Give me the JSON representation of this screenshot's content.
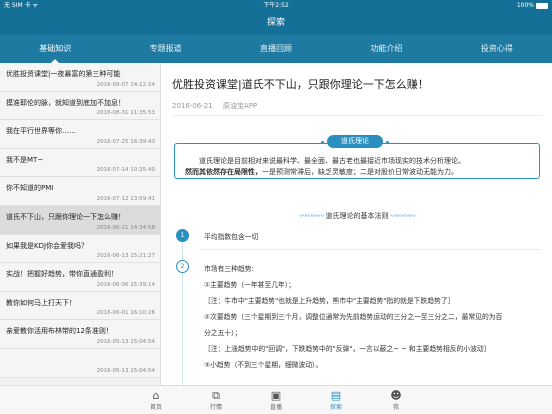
{
  "status_bar": {
    "carrier": "无 SIM 卡 ᯤ",
    "time": "下午2:52",
    "battery": "100%"
  },
  "nav": {
    "title": "探索"
  },
  "tabs": [
    {
      "label": "基础知识"
    },
    {
      "label": "专题报道"
    },
    {
      "label": "直播回顾"
    },
    {
      "label": "功能介绍"
    },
    {
      "label": "投资心得"
    }
  ],
  "list": [
    {
      "title": "优胜投资课堂|一夜暴富的第三种可能",
      "date": "2016-09-07 14:12:24"
    },
    {
      "title": "摸准耶伦的脉，就知道到底加不加息！",
      "date": "2016-08-31 11:35:53"
    },
    {
      "title": "我在平行世界等你……",
      "date": "2016-07-25 16:39:43"
    },
    {
      "title": "我不是MT~",
      "date": "2016-07-14 10:25:40"
    },
    {
      "title": "你不知道的PMI",
      "date": "2016-07-12 13:59:41"
    },
    {
      "title": "道氏不下山，只跟你理论一下怎么赚！",
      "date": "2016-06-21 14:34:58"
    },
    {
      "title": "如果我是KDJ你会爱我吗？",
      "date": "2016-06-13 15:21:27"
    },
    {
      "title": "实战！把握好趋势，带你直通盈利！",
      "date": "2016-06-06 15:39:14"
    },
    {
      "title": "教你如何马上打天下！",
      "date": "2016-06-01 16:10:26"
    },
    {
      "title": "亲爱教你活用布林带的12条准则！",
      "date": "2016-05-13 15:04:54"
    },
    {
      "title": "",
      "date": "2016-05-13 15:04:54"
    }
  ],
  "article": {
    "title": "优胜投资课堂|道氏不下山，只跟你理论一下怎么赚！",
    "date": "2016-06-21",
    "source": "原油宝APP",
    "intro_tag": "道氏理论",
    "intro_line1": "道氏理论是目前相对来说最科学、最全面、最古老也最接近市场现实的技术分析理论。",
    "intro_line2_bold": "然而其依然存在局限性，",
    "intro_line2_rest": "一是预测常滞后，缺乏灵敏度；二是对股价日常波动无能为力。",
    "section_heading": "道氏理论的基本法则",
    "deco": "〰〰〰〰",
    "step1_num": "1",
    "step1_text": "平均指数包含一切",
    "step2_num": "2",
    "step2_lines": [
      "市场有三种趋势:",
      "①主要趋势（一年甚至几年）；",
      "［注：牛市中\"主要趋势\"也就是上升趋势，熊市中\"主要趋势\"指的就是下跌趋势了］",
      "②次要趋势（三个星期到三个月，调整位通常为先前趋势运动的三分之一至三分之二，最常见的为百",
      "分之五十）；",
      "［注：上涨趋势中的\"回调\"，下跌趋势中的\"反弹\"，一言以蔽之~ ~ 和主要趋势相反的小波动］",
      "③小趋势（不到三个星期，细微波动）。"
    ]
  },
  "bottom_tabs": [
    {
      "icon": "⌂",
      "label": "首页"
    },
    {
      "icon": "⧉",
      "label": "行情"
    },
    {
      "icon": "▣",
      "label": "直播"
    },
    {
      "icon": "▤",
      "label": "探索"
    },
    {
      "icon": "☻",
      "label": "我"
    }
  ]
}
